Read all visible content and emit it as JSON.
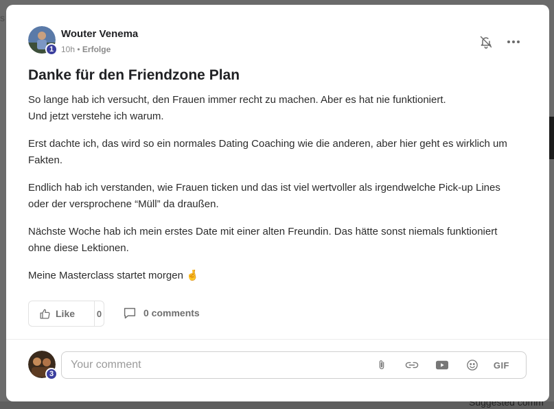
{
  "post": {
    "author": "Wouter Venema",
    "author_level": "1",
    "time": "10h",
    "separator": "•",
    "category": "Erfolge",
    "title": "Danke für den Friendzone Plan",
    "paragraphs": [
      "So lange hab ich versucht, den Frauen immer recht zu machen. Aber es hat nie funktioniert.\nUnd jetzt verstehe ich warum.",
      "Erst dachte ich, das wird so ein normales Dating Coaching wie die anderen, aber hier geht es wirklich um Fakten.",
      "Endlich hab ich verstanden, wie Frauen ticken und das ist viel wertvoller als irgendwelche Pick-up Lines oder der versprochene “Müll” da draußen.",
      "Nächste Woche hab ich mein erstes Date mit einer alten Freundin. Das hätte sonst niemals funktioniert ohne diese Lektionen.",
      "Meine Masterclass startet morgen 🤞"
    ],
    "like_label": "Like",
    "like_count": "0",
    "comments_label": "0 comments"
  },
  "comment": {
    "placeholder": "Your comment",
    "user_level": "3",
    "gif_label": "GIF"
  },
  "background": {
    "fragment_top": "s",
    "fragment_bottom": "Suggested comm"
  },
  "colors": {
    "badge": "#3b3f9e",
    "muted": "#6e6e6e"
  }
}
